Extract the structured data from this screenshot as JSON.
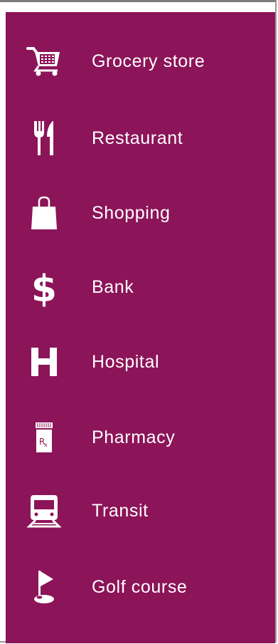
{
  "amenities": [
    {
      "label": "Grocery store",
      "icon": "shopping-cart-icon"
    },
    {
      "label": "Restaurant",
      "icon": "fork-knife-icon"
    },
    {
      "label": "Shopping",
      "icon": "shopping-bag-icon"
    },
    {
      "label": "Bank",
      "icon": "dollar-sign-icon"
    },
    {
      "label": "Hospital",
      "icon": "hospital-h-icon"
    },
    {
      "label": "Pharmacy",
      "icon": "prescription-bottle-icon"
    },
    {
      "label": "Transit",
      "icon": "train-icon"
    },
    {
      "label": "Golf course",
      "icon": "golf-flag-icon"
    }
  ],
  "colors": {
    "panel_background": "#8c1459",
    "text": "#ffffff"
  }
}
